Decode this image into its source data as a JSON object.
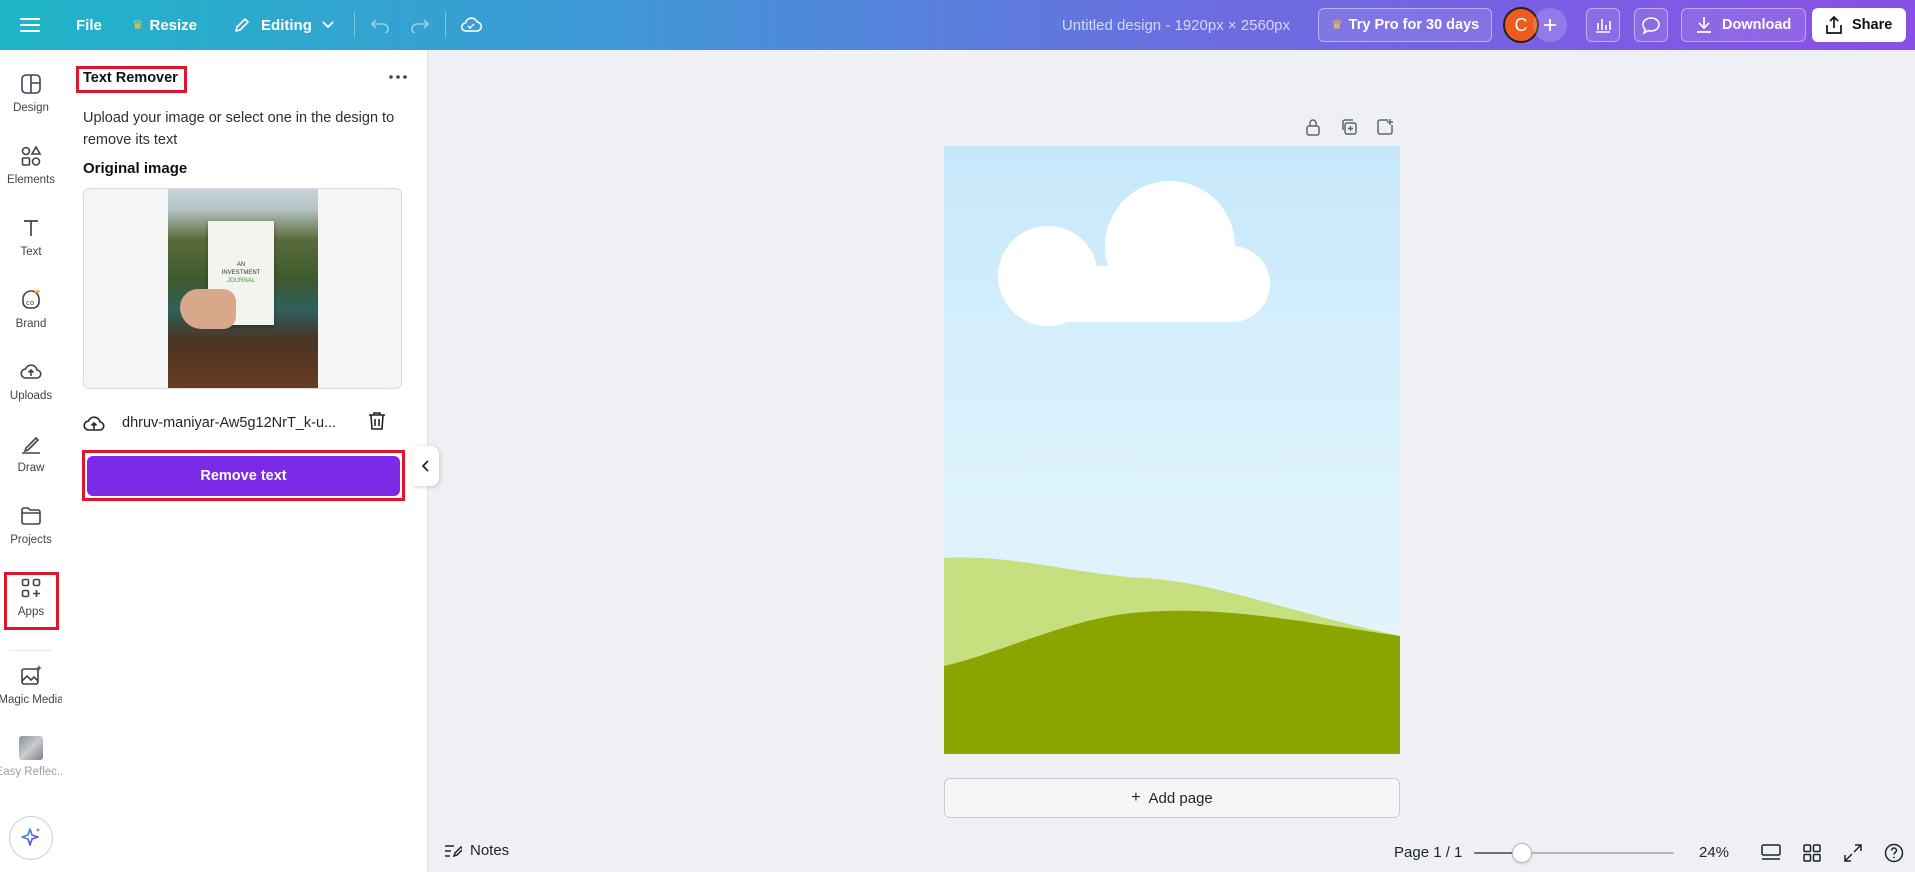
{
  "topbar": {
    "file_label": "File",
    "resize_label": "Resize",
    "editing_label": "Editing",
    "doc_title": "Untitled design - 1920px × 2560px",
    "try_pro_label": "Try Pro for 30 days",
    "avatar_initial": "C",
    "download_label": "Download",
    "share_label": "Share"
  },
  "rail": {
    "items": [
      {
        "label": "Design"
      },
      {
        "label": "Elements"
      },
      {
        "label": "Text"
      },
      {
        "label": "Brand"
      },
      {
        "label": "Uploads"
      },
      {
        "label": "Draw"
      },
      {
        "label": "Projects"
      },
      {
        "label": "Apps"
      },
      {
        "label": "Magic Media"
      },
      {
        "label": "Easy Reflec..."
      }
    ]
  },
  "panel": {
    "title": "Text Remover",
    "description": "Upload your image or select one in the design to remove its text",
    "original_image_label": "Original image",
    "book_text": {
      "line1": "AN",
      "line2": "INVESTMENT",
      "line3": "JOURNAL"
    },
    "file_name": "dhruv-maniyar-Aw5g12NrT_k-u...",
    "remove_button_label": "Remove text"
  },
  "canvas": {
    "add_page_label": "Add page",
    "add_page_icon": "+"
  },
  "bottombar": {
    "notes_label": "Notes",
    "page_count": "Page 1 / 1",
    "zoom": "24%",
    "zoom_fraction": 0.24
  },
  "colors": {
    "accent": "#7d2ae8",
    "highlight": "#e0152e",
    "avatar": "#ef5a1f",
    "hill_light": "#c6df7f",
    "hill_dark": "#8aa400"
  }
}
